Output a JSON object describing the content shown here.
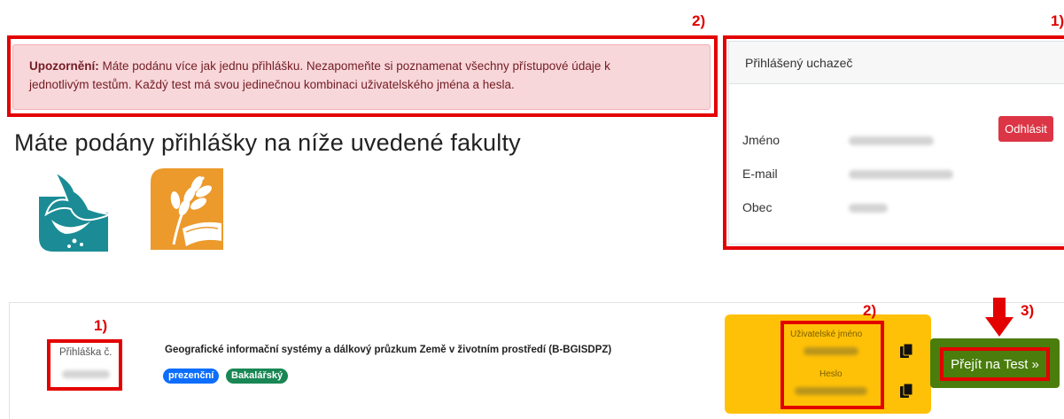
{
  "annotations": {
    "alert_num": "2)",
    "card_num": "1)",
    "appno_num": "1)",
    "cred_num": "2)",
    "go_num": "3)"
  },
  "alert": {
    "bold": "Upozornění:",
    "line1": " Máte podánu více jak jednu přihlášku. Nezapomeňte si poznamenat všechny přístupové údaje k",
    "line2": "jednotlivým testům. Každý test má svou jedinečnou kombinaci uživatelského jména a hesla."
  },
  "page_title": "Máte podány přihlášky na níže uvedené fakulty",
  "logos": [
    "bird-logo",
    "wheat-book-logo"
  ],
  "applicant_card": {
    "header": "Přihlášený uchazeč",
    "logout_label": "Odhlásit",
    "fields": [
      {
        "label": "Jméno"
      },
      {
        "label": "E-mail"
      },
      {
        "label": "Obec"
      }
    ]
  },
  "application": {
    "number_label": "Přihláška č.",
    "program_title": "Geografické informační systémy a dálkový průzkum Země v životním prostředí (B-BGISDPZ)",
    "badges": [
      "prezenční",
      "Bakalářský"
    ],
    "username_label": "Uživatelské jméno",
    "password_label": "Heslo",
    "go_label": "Přejít na Test »"
  },
  "colors": {
    "annotation_red": "#e30000",
    "alert_bg": "#f8d7da",
    "logout_red": "#dc3545",
    "credentials_yellow": "#ffc107",
    "go_green": "#4a7d0c",
    "badge_blue": "#0d6efd",
    "badge_green": "#198754"
  }
}
